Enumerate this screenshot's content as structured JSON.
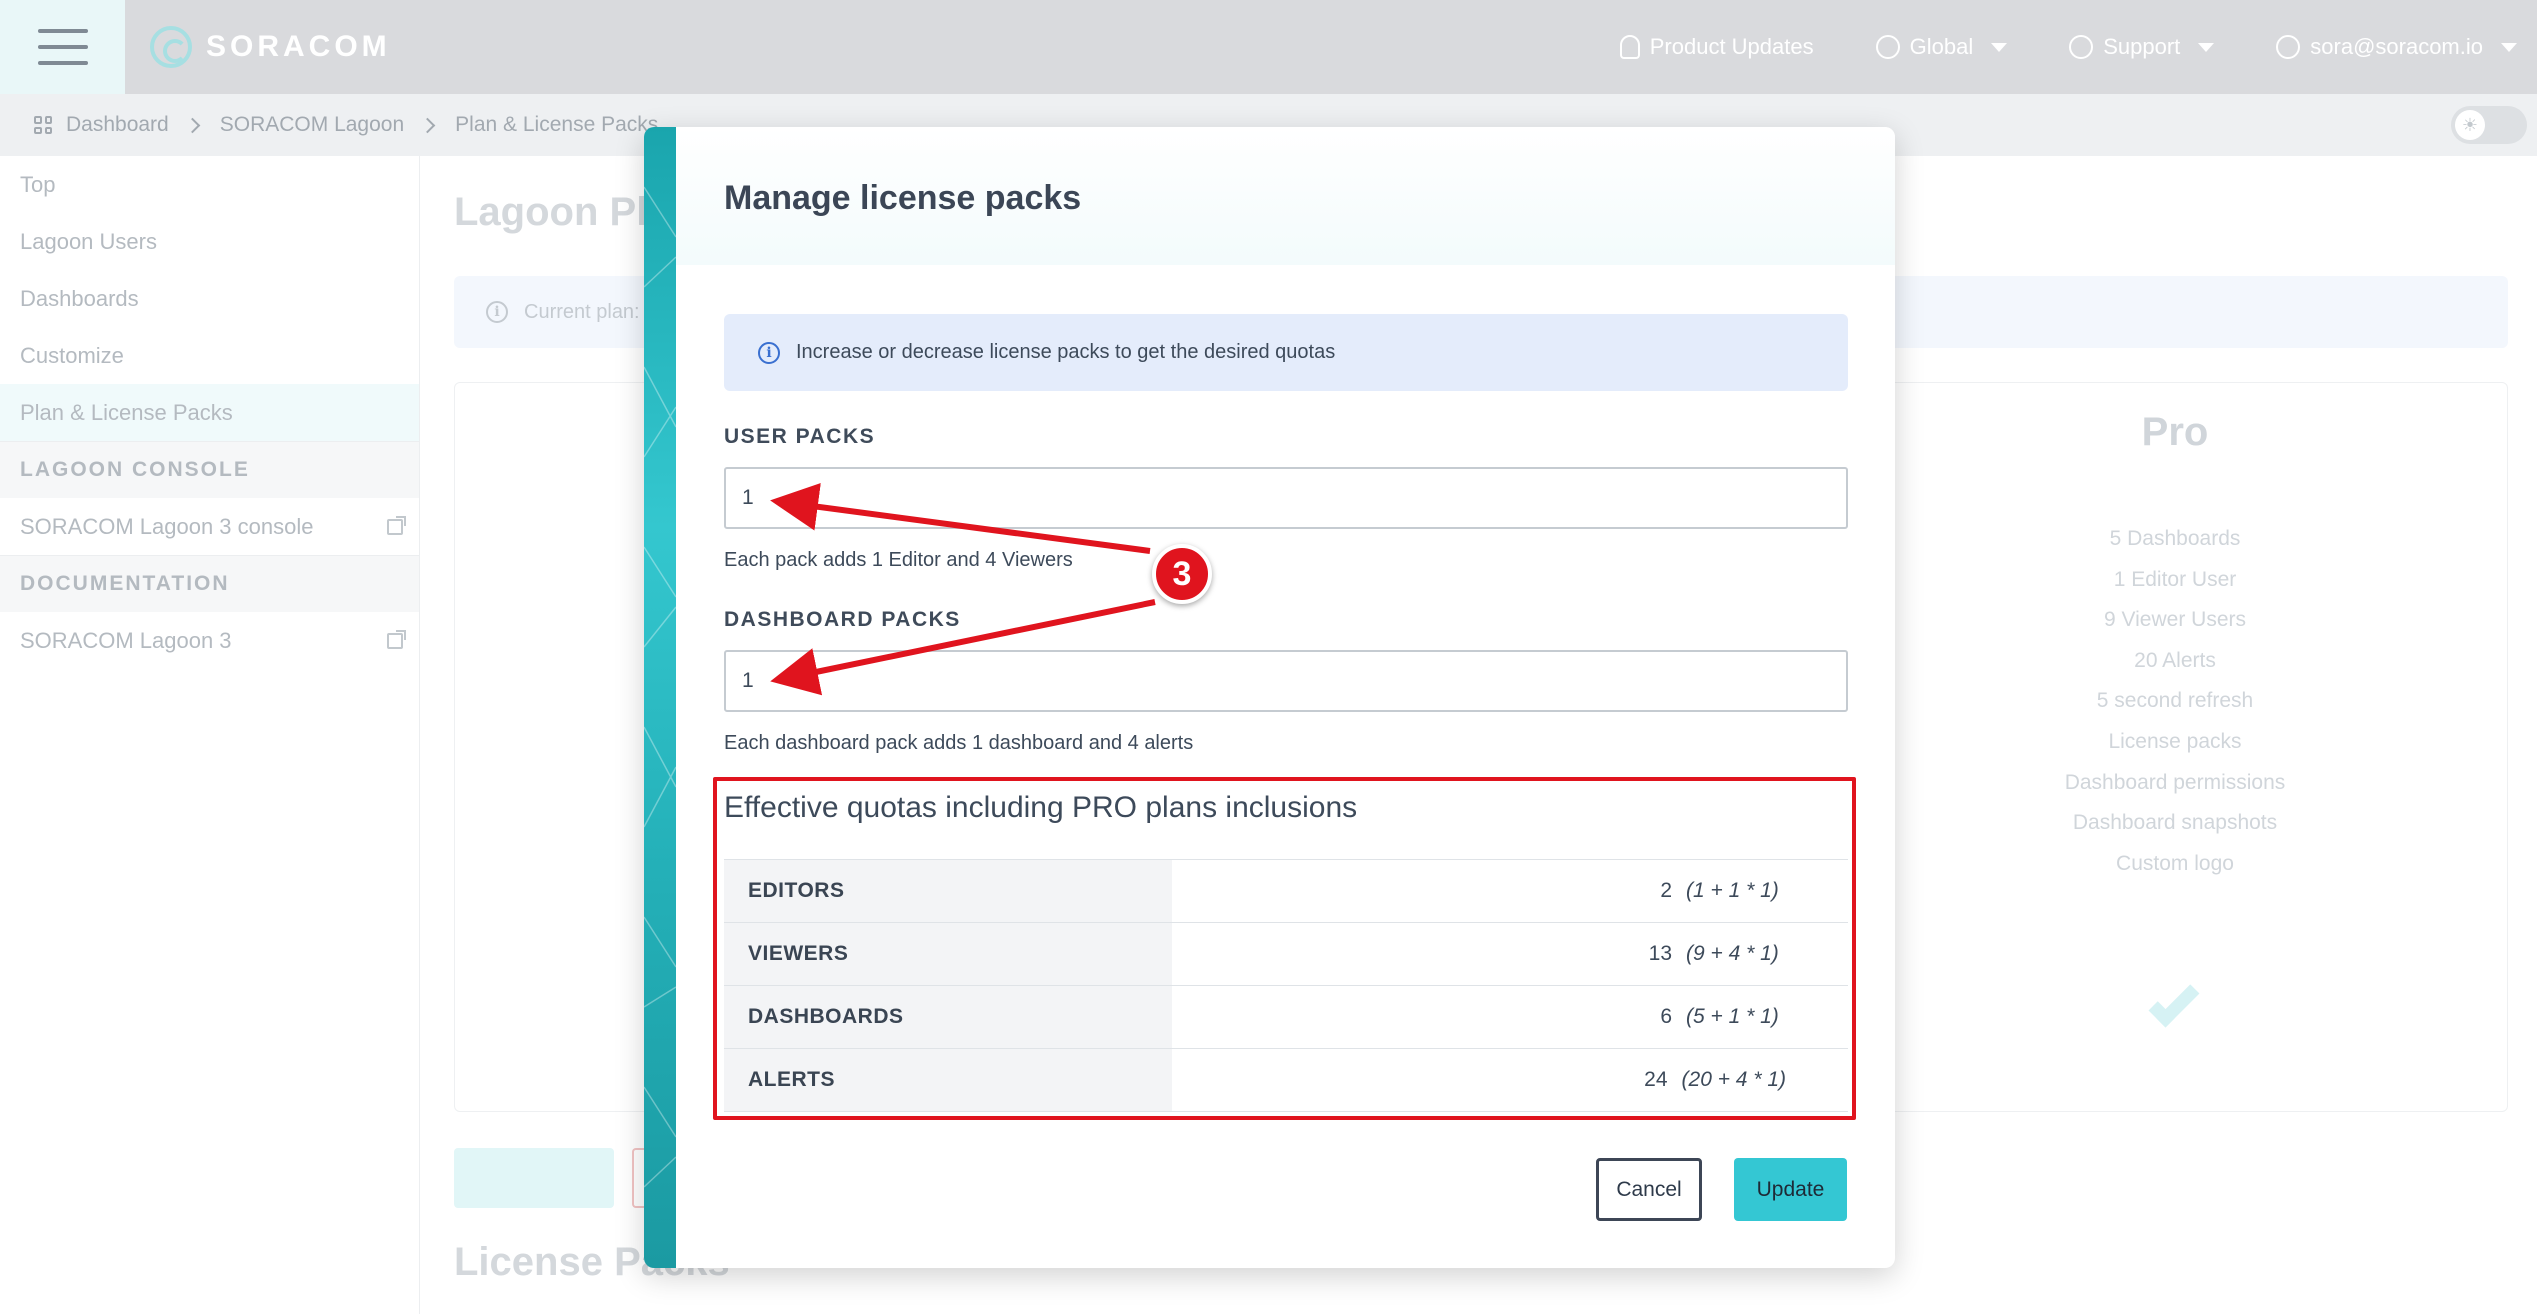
{
  "header": {
    "brand": "SORACOM",
    "nav": {
      "product_updates": "Product Updates",
      "global": "Global",
      "support": "Support",
      "user": "sora@soracom.io"
    }
  },
  "breadcrumb": [
    "Dashboard",
    "SORACOM Lagoon",
    "Plan & License Packs"
  ],
  "sidebar": {
    "items": [
      "Top",
      "Lagoon Users",
      "Dashboards",
      "Customize",
      "Plan & License Packs"
    ],
    "section_console": "LAGOON CONSOLE",
    "console_link": "SORACOM Lagoon 3 console",
    "section_docs": "DOCUMENTATION",
    "docs_link": "SORACOM Lagoon 3"
  },
  "background": {
    "title": "Lagoon Pla",
    "current_plan": "Current plan:",
    "pro": {
      "title": "Pro",
      "features": [
        "5 Dashboards",
        "1 Editor User",
        "9 Viewer Users",
        "20 Alerts",
        "5 second refresh",
        "License packs",
        "Dashboard permissions",
        "Dashboard snapshots",
        "Custom logo"
      ]
    },
    "license_title": "License Packs"
  },
  "modal": {
    "title": "Manage license packs",
    "info": "Increase or decrease license packs to get the desired quotas",
    "user_packs": {
      "label": "USER PACKS",
      "value": "1",
      "help": "Each pack adds 1 Editor and 4 Viewers"
    },
    "dashboard_packs": {
      "label": "DASHBOARD PACKS",
      "value": "1",
      "help": "Each dashboard pack adds 1 dashboard and 4 alerts"
    },
    "quotas": {
      "title": "Effective quotas including PRO plans inclusions",
      "rows": [
        {
          "label": "EDITORS",
          "value": "2",
          "formula": "(1 + 1 * 1)"
        },
        {
          "label": "VIEWERS",
          "value": "13",
          "formula": "(9 + 4 * 1)"
        },
        {
          "label": "DASHBOARDS",
          "value": "6",
          "formula": "(5 + 1 * 1)"
        },
        {
          "label": "ALERTS",
          "value": "24",
          "formula": "(20 + 4 * 1)"
        }
      ]
    },
    "cancel": "Cancel",
    "update": "Update"
  },
  "annotation": {
    "step": "3",
    "color": "#e0141e"
  }
}
